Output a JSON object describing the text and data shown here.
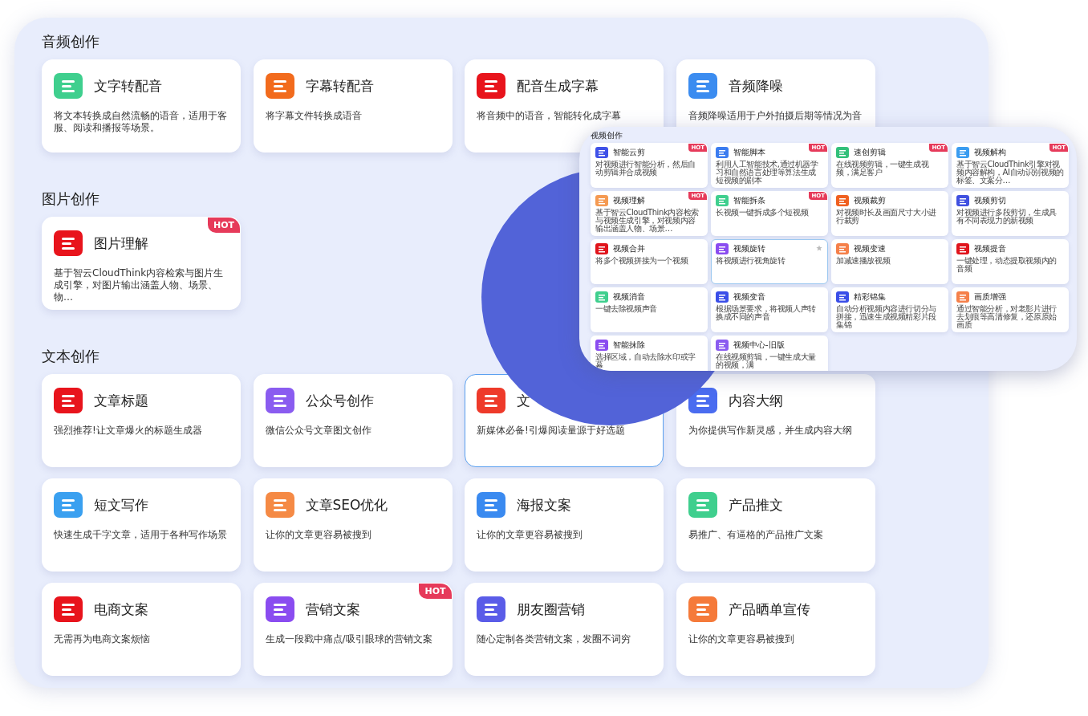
{
  "sections": [
    {
      "title": "音频创作",
      "cards": [
        {
          "title": "文字转配音",
          "desc": "将文本转换成自然流畅的语音，适用于客服、阅读和播报等场景。",
          "color": "#3fcf8e",
          "selected": false
        },
        {
          "title": "字幕转配音",
          "desc": "将字幕文件转换成语音",
          "color": "#f26b1d",
          "selected": false
        },
        {
          "title": "配音生成字幕",
          "desc": "将音频中的语音，智能转化成字幕",
          "color": "#e8141c",
          "selected": false
        },
        {
          "title": "音频降噪",
          "desc": "音频降噪适用于户外拍摄后期等情况为音",
          "color": "#3b8cf0",
          "selected": false
        }
      ]
    },
    {
      "title": "图片创作",
      "cards": [
        {
          "title": "图片理解",
          "desc": "基于智云CloudThink内容检索与图片生成引擎，对图片输出涵盖人物、场景、物…",
          "color": "#e8141c",
          "badge": "HOT",
          "selected": false
        }
      ]
    },
    {
      "title": "文本创作",
      "cards": [
        {
          "title": "文章标题",
          "desc": "强烈推荐!让文章爆火的标题生成器",
          "color": "#e8141c",
          "selected": false
        },
        {
          "title": "公众号创作",
          "desc": "微信公众号文章图文创作",
          "color": "#8a5cf0",
          "selected": false
        },
        {
          "title": "文",
          "desc": "新媒体必备!引爆阅读量源于好选题",
          "color": "#ee3a2a",
          "selected": true
        },
        {
          "title": "内容大纲",
          "desc": "为你提供写作新灵感，并生成内容大纲",
          "color": "#4a6cf0",
          "selected": false
        },
        {
          "title": "短文写作",
          "desc": "快速生成千字文章，适用于各种写作场景",
          "color": "#3aa0f0",
          "selected": false
        },
        {
          "title": "文章SEO优化",
          "desc": "让你的文章更容易被搜到",
          "color": "#f58a45",
          "selected": false
        },
        {
          "title": "海报文案",
          "desc": "让你的文章更容易被搜到",
          "color": "#3a8af0",
          "selected": false
        },
        {
          "title": "产品推文",
          "desc": "易推广、有逼格的产品推广文案",
          "color": "#3fcf8e",
          "selected": false
        },
        {
          "title": "电商文案",
          "desc": "无需再为电商文案烦恼",
          "color": "#e8141c",
          "selected": false
        },
        {
          "title": "营销文案",
          "desc": "生成一段戳中痛点/吸引眼球的营销文案",
          "color": "#8a4cf0",
          "badge": "HOT",
          "selected": false
        },
        {
          "title": "朋友圈营销",
          "desc": "随心定制各类营销文案，发圈不词穷",
          "color": "#5a5ce8",
          "selected": false
        },
        {
          "title": "产品晒单宣传",
          "desc": "让你的文章更容易被搜到",
          "color": "#f57a3a",
          "selected": false
        }
      ]
    }
  ],
  "overlay": {
    "title": "视频创作",
    "cards": [
      {
        "title": "智能云剪",
        "desc": "对视频进行智能分析，然后自动剪辑并合成视频",
        "color": "#3f51e8",
        "badge": "HOT",
        "selected": false
      },
      {
        "title": "智能脚本",
        "desc": "利用人工智能技术,通过机器学习和自然语言处理等算法生成短视频的剧本",
        "color": "#3b7cf0",
        "badge": "HOT",
        "selected": false
      },
      {
        "title": "速创剪辑",
        "desc": "在线视频剪辑，一键生成视频，满足客户",
        "color": "#33c07a",
        "badge": "HOT",
        "selected": false
      },
      {
        "title": "视频解构",
        "desc": "基于智云CloudThink引擎对视频内容解构，AI自动识别视频的标签、文案分…",
        "color": "#3a9cf0",
        "badge": "HOT",
        "selected": false
      },
      {
        "title": "视频理解",
        "desc": "基于智云CloudThink内容检索与视频生成引擎，对视频内容输出涵盖人物、场景…",
        "color": "#f59a52",
        "badge": "HOT",
        "selected": false
      },
      {
        "title": "智能拆条",
        "desc": "长视频一键拆成多个短视频",
        "color": "#3fcf8e",
        "badge": "HOT",
        "selected": false
      },
      {
        "title": "视频裁剪",
        "desc": "对视频时长及画面尺寸大小进行裁剪",
        "color": "#f06020",
        "selected": false
      },
      {
        "title": "视频剪切",
        "desc": "对视频进行多段剪切，生成具有不同表现力的新视频",
        "color": "#4050e0",
        "selected": false
      },
      {
        "title": "视频合并",
        "desc": "将多个视频拼接为一个视频",
        "color": "#e0141c",
        "selected": false
      },
      {
        "title": "视频旋转",
        "desc": "将视频进行视角旋转",
        "color": "#8a4cf0",
        "selected": true
      },
      {
        "title": "视频变速",
        "desc": "加减速播放视频",
        "color": "#f5804a",
        "selected": false
      },
      {
        "title": "视频提音",
        "desc": "一键处理，动态提取视频内的音频",
        "color": "#e0141c",
        "selected": false
      },
      {
        "title": "视频消音",
        "desc": "一键去除视频声音",
        "color": "#3fcf8e",
        "selected": false
      },
      {
        "title": "视频变音",
        "desc": "根据场景要求，将视频人声转换成不同的声音",
        "color": "#3a4ee8",
        "selected": false
      },
      {
        "title": "精彩锦集",
        "desc": "自动分析视频内容进行切分与拼接，迅速生成视频精彩片段集锦",
        "color": "#3a4ee8",
        "selected": false
      },
      {
        "title": "画质增强",
        "desc": "通过智能分析，对老影片进行去划痕等高清修复，还原原始画质",
        "color": "#f5804a",
        "selected": false
      },
      {
        "title": "智能抹除",
        "desc": "选择区域，自动去除水印或字幕",
        "color": "#8a4cf0",
        "selected": false
      },
      {
        "title": "视频中心-旧版",
        "desc": "在线视频剪辑，一键生成大量的视频，满",
        "color": "#8a5cf0",
        "selected": false
      }
    ]
  }
}
